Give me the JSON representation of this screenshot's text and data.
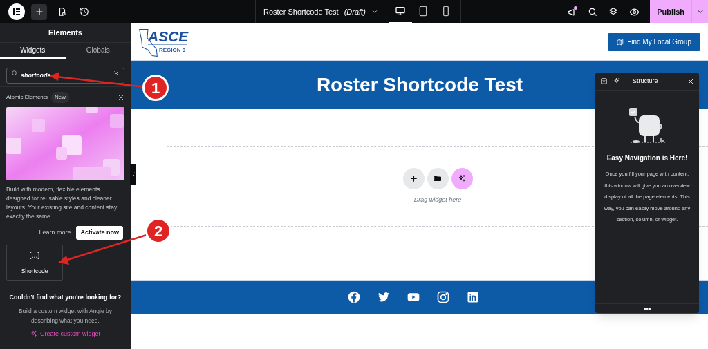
{
  "topbar": {
    "page_title": "Roster Shortcode Test",
    "status": "(Draft)",
    "publish": "Publish",
    "devices": [
      {
        "kind": "desktop",
        "selected": true
      },
      {
        "kind": "tablet",
        "selected": false
      },
      {
        "kind": "mobile",
        "selected": false
      }
    ]
  },
  "panel": {
    "title": "Elements",
    "tabs": [
      {
        "label": "Widgets",
        "selected": true
      },
      {
        "label": "Globals",
        "selected": false
      }
    ],
    "search": {
      "value": "shortcode"
    },
    "promo": {
      "title": "Atomic Elements",
      "badge": "New",
      "text": "Build with modern, flexible elements designed for reusable styles and cleaner layouts. Your existing site and content stay exactly the same.",
      "learn_more": "Learn more",
      "activate": "Activate now"
    },
    "widgets": [
      {
        "icon": "[...]",
        "label": "Shortcode"
      }
    ],
    "help": {
      "title": "Couldn't find what you're looking for?",
      "text": "Build a custom widget with Angie by describing what you need.",
      "link": "Create custom widget"
    }
  },
  "page": {
    "logo": {
      "name": "ASCE",
      "region": "REGION 9"
    },
    "header_button": "Find My Local Group",
    "title": "Roster Shortcode Test",
    "drop_hint": "Drag widget here",
    "social": [
      {
        "kind": "facebook"
      },
      {
        "kind": "twitter"
      },
      {
        "kind": "youtube"
      },
      {
        "kind": "instagram"
      },
      {
        "kind": "linkedin"
      }
    ]
  },
  "structure": {
    "title": "Structure",
    "heading": "Easy Navigation is Here!",
    "text": "Once you fill your page with content, this window will give you an overview display of all the page elements. This way, you can easily move around any section, column, or widget."
  },
  "callouts": [
    {
      "number": "1"
    },
    {
      "number": "2"
    }
  ]
}
